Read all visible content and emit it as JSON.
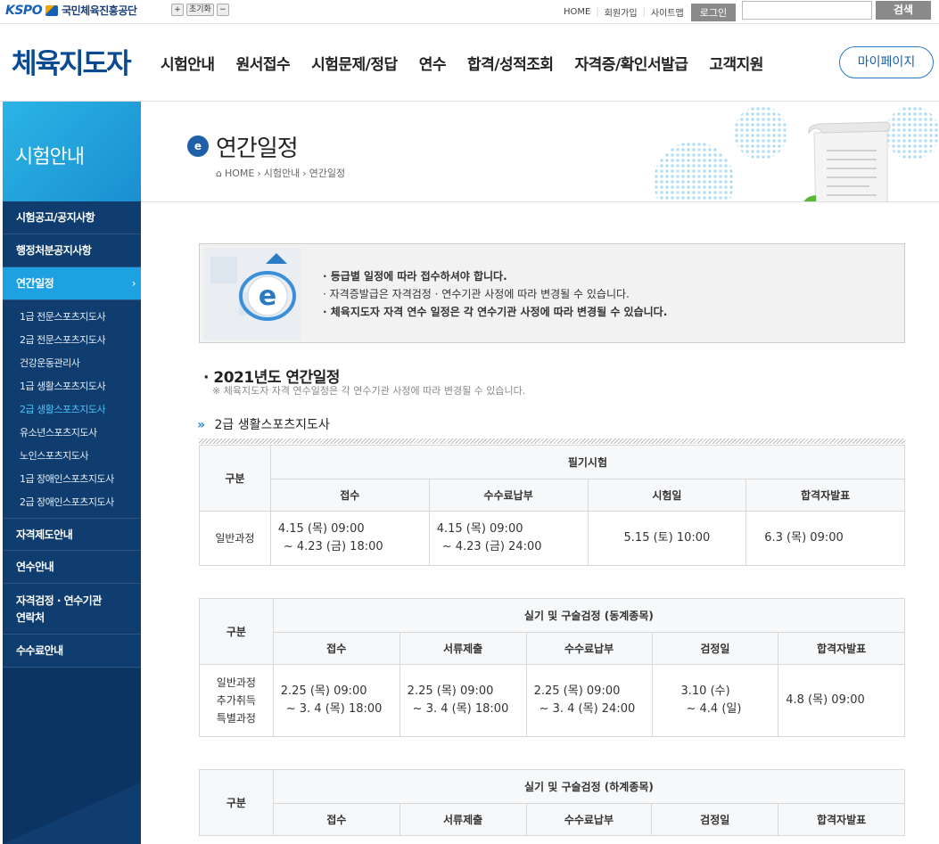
{
  "topbar": {
    "org_mark": "KSPO",
    "org_name": "국민체육진흥공단",
    "font_plus": "+",
    "font_reset": "초기화",
    "font_minus": "−",
    "links": [
      "HOME",
      "회원가입",
      "사이트맵"
    ],
    "login": "로그인",
    "search_value": "",
    "search_button": "검색"
  },
  "gnb": {
    "logo": "체육지도자",
    "menu": [
      "시험안내",
      "원서접수",
      "시험문제/정답",
      "연수",
      "합격/성적조회",
      "자격증/확인서발급",
      "고객지원"
    ],
    "mypage": "마이페이지"
  },
  "sidebar": {
    "title": "시험안내",
    "items": [
      "시험공고/공지사항",
      "행정처분공지사항",
      "연간일정"
    ],
    "active_arrow": "›",
    "subitems": [
      "1급 전문스포츠지도사",
      "2급 전문스포츠지도사",
      "건강운동관리사",
      "1급 생활스포츠지도사",
      "2급 생활스포츠지도사",
      "유소년스포츠지도사",
      "노인스포츠지도사",
      "1급 장애인스포츠지도사",
      "2급 장애인스포츠지도사"
    ],
    "items2": [
      "자격제도안내",
      "연수안내"
    ],
    "item_tall_1": "자격검정 · 연수기관",
    "item_tall_2": "연락처",
    "item_last": "수수료안내"
  },
  "page": {
    "icon_letter": "e",
    "title": "연간일정",
    "breadcrumb": [
      "HOME",
      "시험안내",
      "연간일정"
    ]
  },
  "notice": {
    "lines": [
      "· 등급별 일정에 따라 접수하셔야 합니다.",
      "· 자격증발급은 자격검정 · 연수기관 사정에 따라 변경될 수 있습니다.",
      "· 체육지도자 자격 연수 일정은 각 연수기관 사정에 따라 변경될 수 있습니다."
    ]
  },
  "section": {
    "title": "· 2021년도 연간일정",
    "note": "※ 체육지도자 자격 연수일정은 각 연수기관 사정에 따라 변경될 수 있습니다.",
    "sub_arrow": "»",
    "sub_title": "2급 생활스포츠지도사"
  },
  "table1": {
    "corner": "구분",
    "group": "필기시험",
    "cols": [
      "접수",
      "수수료납부",
      "시험일",
      "합격자발표"
    ],
    "row_label": "일반과정",
    "cells": [
      [
        "4.15 (목) 09:00",
        "~ 4.23 (금) 18:00"
      ],
      [
        "4.15 (목) 09:00",
        "~ 4.23 (금) 24:00"
      ],
      [
        "5.15 (토) 10:00"
      ],
      [
        "6.3 (목) 09:00"
      ]
    ]
  },
  "table2": {
    "corner": "구분",
    "group": "실기 및 구술검정 (동계종목)",
    "cols": [
      "접수",
      "서류제출",
      "수수료납부",
      "검정일",
      "합격자발표"
    ],
    "row_label": [
      "일반과정",
      "추가취득",
      "특별과정"
    ],
    "cells": [
      [
        "2.25 (목) 09:00",
        "~ 3. 4 (목) 18:00"
      ],
      [
        "2.25 (목) 09:00",
        "~ 3. 4 (목) 18:00"
      ],
      [
        "2.25 (목) 09:00",
        "~ 3. 4 (목) 24:00"
      ],
      [
        "3.10 (수)",
        "~ 4.4 (일)"
      ],
      [
        "4.8 (목) 09:00"
      ]
    ]
  },
  "table3": {
    "corner": "구분",
    "group": "실기 및 구술검정 (하계종목)",
    "cols": [
      "접수",
      "서류제출",
      "수수료납부",
      "검정일",
      "합격자발표"
    ]
  }
}
